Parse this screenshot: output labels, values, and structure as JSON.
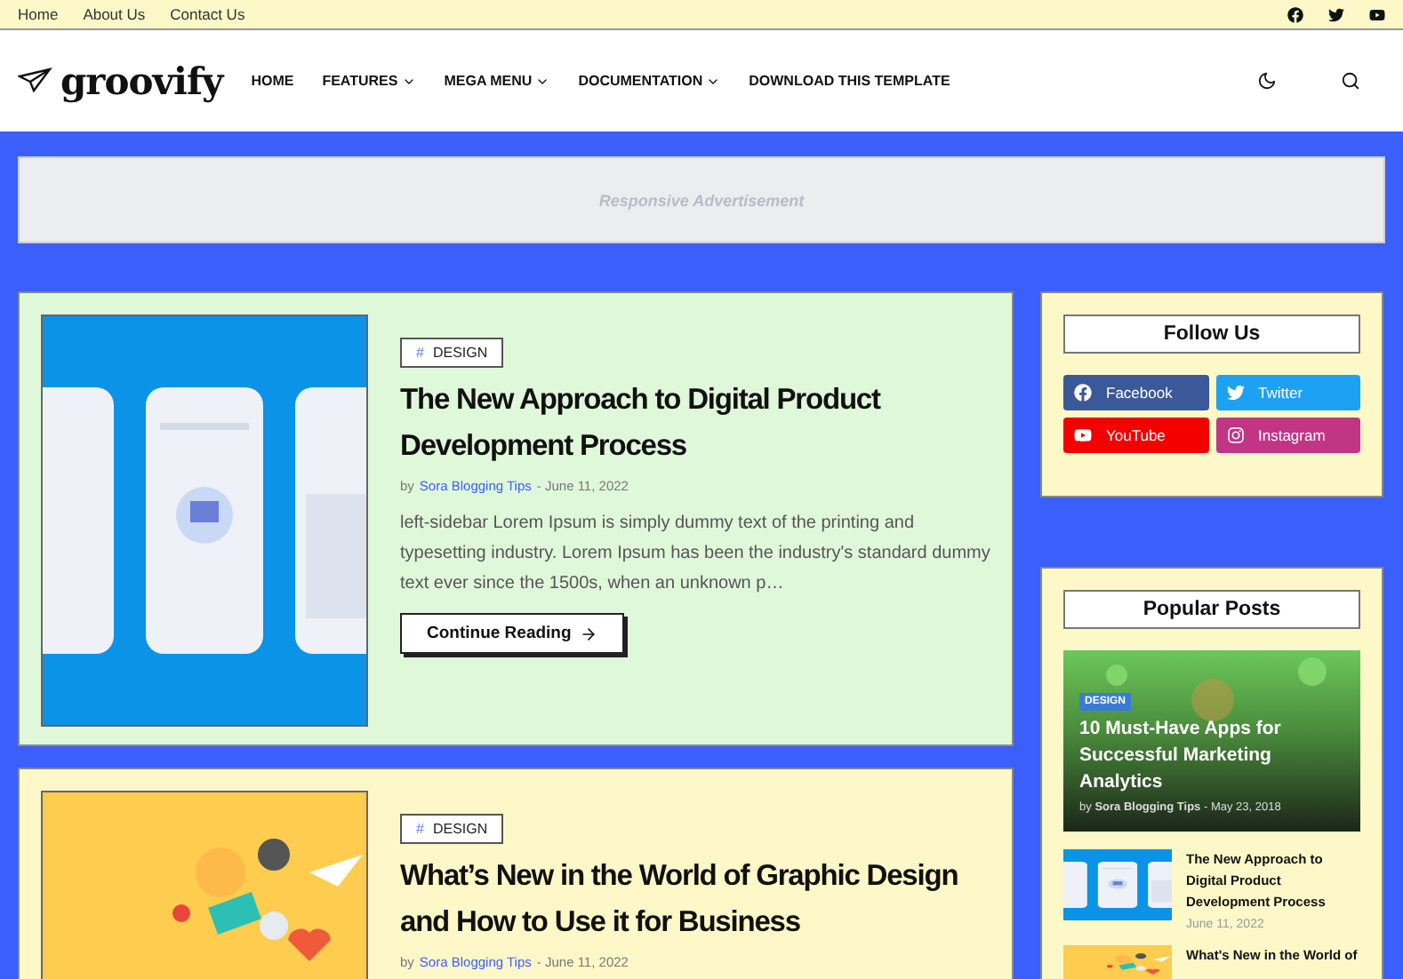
{
  "top_links": [
    "Home",
    "About Us",
    "Contact Us"
  ],
  "social_icons": [
    {
      "kind": "facebook"
    },
    {
      "kind": "twitter"
    },
    {
      "kind": "youtube"
    }
  ],
  "logo": "groovify",
  "nav": [
    {
      "label": "HOME",
      "dropdown": false
    },
    {
      "label": "FEATURES",
      "dropdown": true
    },
    {
      "label": "MEGA MENU",
      "dropdown": true
    },
    {
      "label": "DOCUMENTATION",
      "dropdown": true
    },
    {
      "label": "DOWNLOAD THIS TEMPLATE",
      "dropdown": false
    }
  ],
  "ad": "Responsive Advertisement",
  "posts": [
    {
      "tag_mark": "#",
      "tag": "DESIGN",
      "title": "The New Approach to Digital Product Development Process",
      "by": "by",
      "author": "Sora Blogging Tips",
      "date": "- June 11, 2022",
      "excerpt": "left-sidebar Lorem Ipsum is simply dummy text of the printing and typesetting industry. Lorem Ipsum has been the industry's standard dummy text ever since the 1500s, when an unknown p…",
      "button": "Continue Reading",
      "color": "#e0f8da",
      "kind": "phones"
    },
    {
      "tag_mark": "#",
      "tag": "DESIGN",
      "title": "What’s New in the World of Graphic Design and How to Use it for Business",
      "by": "by",
      "author": "Sora Blogging Tips",
      "date": "- June 11, 2022",
      "color": "#fef8c8",
      "kind": "graphic"
    }
  ],
  "follow": {
    "title": "Follow Us",
    "buttons": [
      {
        "label": "Facebook",
        "kind": "facebook",
        "color": "#3b5998"
      },
      {
        "label": "Twitter",
        "kind": "twitter",
        "color": "#1da1f2"
      },
      {
        "label": "YouTube",
        "kind": "youtube",
        "color": "#f50000"
      },
      {
        "label": "Instagram",
        "kind": "instagram",
        "color": "#c13584"
      }
    ]
  },
  "popular": {
    "title": "Popular Posts",
    "featured": {
      "tag": "DESIGN",
      "title": "10 Must-Have Apps for Successful Marketing Analytics",
      "by": "by",
      "author": "Sora Blogging Tips",
      "date": "- May 23, 2018"
    },
    "items": [
      {
        "title": "The New Approach to Digital Product Development Process",
        "date": "June 11, 2022",
        "kind": "phones"
      },
      {
        "title": "What's New in the World of",
        "kind": "graphic"
      }
    ]
  }
}
